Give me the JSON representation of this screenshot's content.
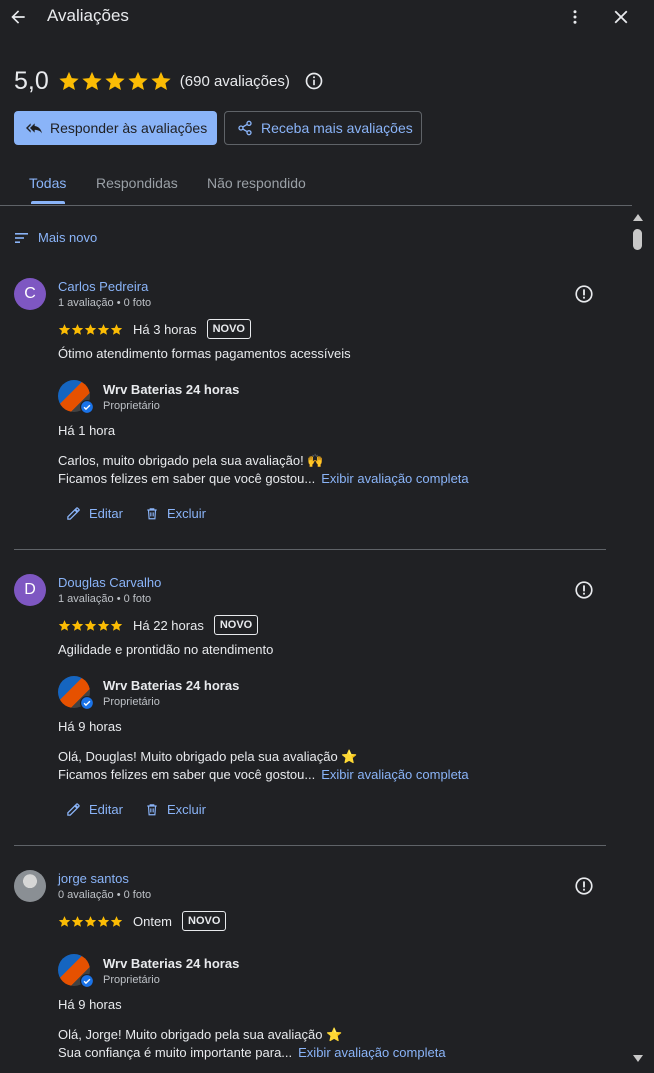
{
  "header": {
    "title": "Avaliações",
    "back_icon": "back-arrow-icon",
    "more_icon": "more-vert-icon",
    "close_icon": "close-icon"
  },
  "summary": {
    "rating": "5,0",
    "stars": 5,
    "count": "(690 avaliações)",
    "info_icon": "info-icon"
  },
  "buttons": {
    "respond": "Responder às avaliações",
    "get_more": "Receba mais avaliações"
  },
  "tabs": [
    {
      "label": "Todas",
      "active": true
    },
    {
      "label": "Respondidas",
      "active": false
    },
    {
      "label": "Não respondido",
      "active": false
    }
  ],
  "sort": {
    "label": "Mais novo"
  },
  "owner": {
    "name": "Wrv Baterias 24 horas",
    "role": "Proprietário"
  },
  "reviews": [
    {
      "initial": "C",
      "name": "Carlos Pedreira",
      "meta": "1 avaliação • 0 foto",
      "stars": 5,
      "time": "Há 3 horas",
      "badge": "NOVO",
      "text": "Ótimo atendimento formas pagamentos acessíveis",
      "reply_time": "Há 1 hora",
      "reply_line1": "Carlos, muito obrigado pela sua avaliação! 🙌",
      "reply_line2": "Ficamos felizes em saber que você gostou...",
      "reply_link": "Exibir avaliação completa",
      "edit": "Editar",
      "delete": "Excluir"
    },
    {
      "initial": "D",
      "name": "Douglas Carvalho",
      "meta": "1 avaliação • 0 foto",
      "stars": 5,
      "time": "Há 22 horas",
      "badge": "NOVO",
      "text": "Agilidade e prontidão no atendimento",
      "reply_time": "Há 9 horas",
      "reply_line1": "Olá, Douglas! Muito obrigado pela sua avaliação ⭐",
      "reply_line2": "Ficamos felizes em saber que você gostou...",
      "reply_link": "Exibir avaliação completa",
      "edit": "Editar",
      "delete": "Excluir"
    },
    {
      "initial": "",
      "name": "jorge santos",
      "meta": "0 avaliação • 0 foto",
      "stars": 5,
      "time": "Ontem",
      "badge": "NOVO",
      "text": "",
      "reply_time": "Há 9 horas",
      "reply_line1": "Olá, Jorge! Muito obrigado pela sua avaliação ⭐",
      "reply_line2": "Sua confiança é muito importante para...",
      "reply_link": "Exibir avaliação completa"
    }
  ],
  "colors": {
    "background": "#202124",
    "accent": "#8ab4f8",
    "star": "#fbbc04",
    "avatar": "#7e57c2"
  }
}
